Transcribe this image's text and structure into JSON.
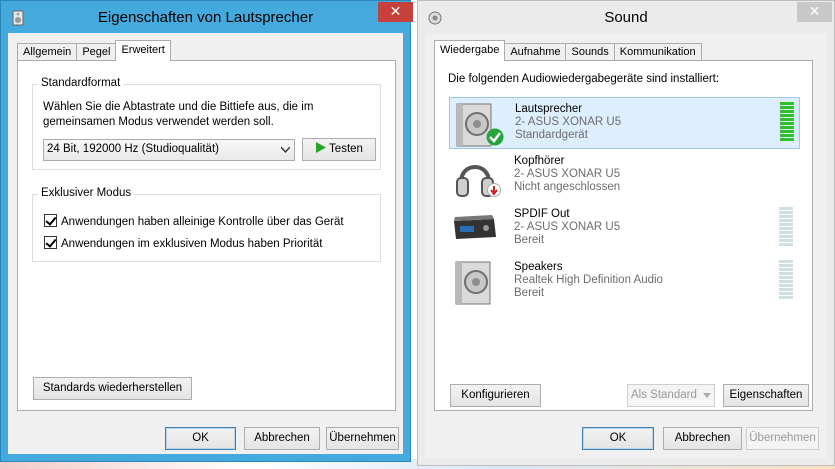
{
  "left_window": {
    "title": "Eigenschaften von Lautsprecher",
    "close_glyph": "✕",
    "tabs": [
      "Allgemein",
      "Pegel",
      "Erweitert"
    ],
    "active_tab": "Erweitert",
    "standard_format": {
      "legend": "Standardformat",
      "description": "Wählen Sie die Abtastrate und die Bittiefe aus, die im gemeinsamen Modus verwendet werden soll.",
      "selected_format": "24 Bit, 192000 Hz (Studioqualität)",
      "test_button": "Testen"
    },
    "exclusive_mode": {
      "legend": "Exklusiver Modus",
      "options": [
        {
          "label": "Anwendungen haben alleinige Kontrolle über das Gerät",
          "checked": true
        },
        {
          "label": "Anwendungen im exklusiven Modus haben Priorität",
          "checked": true
        }
      ]
    },
    "restore_button": "Standards wiederherstellen",
    "ok_button": "OK",
    "cancel_button": "Abbrechen",
    "apply_button": "Übernehmen"
  },
  "right_window": {
    "title": "Sound",
    "close_glyph": "✕",
    "tabs": [
      "Wiedergabe",
      "Aufnahme",
      "Sounds",
      "Kommunikation"
    ],
    "active_tab": "Wiedergabe",
    "intro": "Die folgenden Audiowiedergabegeräte sind installiert:",
    "devices": [
      {
        "name": "Lautsprecher",
        "driver": "2- ASUS XONAR U5",
        "status": "Standardgerät",
        "icon": "speaker-icon",
        "badge": "default-check-icon",
        "meter_level": 1.0,
        "selected": true
      },
      {
        "name": "Kopfhörer",
        "driver": "2- ASUS XONAR U5",
        "status": "Nicht angeschlossen",
        "icon": "headphones-icon",
        "badge": "unplugged-icon",
        "meter_level": null,
        "selected": false
      },
      {
        "name": "SPDIF Out",
        "driver": "2- ASUS XONAR U5",
        "status": "Bereit",
        "icon": "spdif-device-icon",
        "badge": "",
        "meter_level": 0,
        "selected": false
      },
      {
        "name": "Speakers",
        "driver": "Realtek High Definition Audio",
        "status": "Bereit",
        "icon": "speaker-icon",
        "badge": "",
        "meter_level": 0,
        "selected": false
      }
    ],
    "configure_button": "Konfigurieren",
    "set_default_button": "Als Standard",
    "properties_button": "Eigenschaften",
    "ok_button": "OK",
    "cancel_button": "Abbrechen",
    "apply_button": "Übernehmen"
  }
}
